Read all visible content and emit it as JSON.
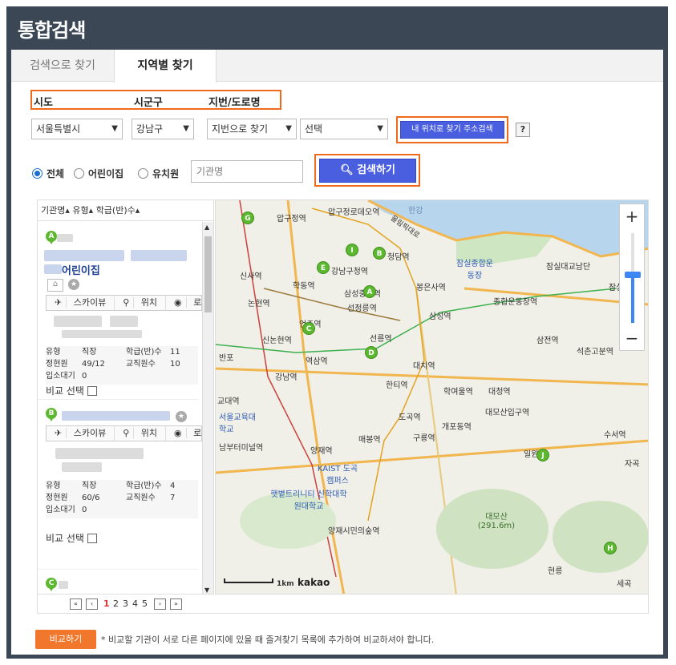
{
  "header": {
    "title": "통합검색"
  },
  "tabs": [
    {
      "label": "검색으로 찾기"
    },
    {
      "label": "지역별 찾기"
    }
  ],
  "filters": {
    "labels": {
      "sido": "시도",
      "sigungu": "시군구",
      "road": "지번/도로명"
    },
    "sido_value": "서울특별시",
    "sigungu_value": "강남구",
    "road_type_value": "지번으로 찾기",
    "detail_value": "선택",
    "locate_button": "내 위치로 찾기 주소검색",
    "help_button": "?"
  },
  "type_filter": {
    "options": [
      "전체",
      "어린이집",
      "유치원"
    ],
    "selected": "전체",
    "search_placeholder": "기관명",
    "search_button": "검색하기"
  },
  "list": {
    "headers": [
      "기관명",
      "유형",
      "학급(반)수"
    ],
    "cards": [
      {
        "marker": "A",
        "name": "어린이집",
        "actions": [
          "스카이뷰",
          "위치",
          "로드뷰"
        ],
        "type_label": "유형",
        "type_value": "직장",
        "class_label": "학급(반)수",
        "class_value": "11",
        "capacity_label": "정현원",
        "capacity_value": "49/12",
        "staff_label": "교직원수",
        "staff_value": "10",
        "waiting_label": "입소대기",
        "waiting_value": "0",
        "compare_label": "비교 선택"
      },
      {
        "marker": "B",
        "name": "",
        "actions": [
          "스카이뷰",
          "위치",
          "로드뷰"
        ],
        "type_label": "유형",
        "type_value": "직장",
        "class_label": "학급(반)수",
        "class_value": "4",
        "capacity_label": "정현원",
        "capacity_value": "60/6",
        "staff_label": "교직원수",
        "staff_value": "7",
        "waiting_label": "입소대기",
        "waiting_value": "0",
        "compare_label": "비교 선택"
      },
      {
        "marker": "C"
      }
    ]
  },
  "pagination": {
    "pages": [
      "1",
      "2",
      "3",
      "4",
      "5"
    ],
    "current": "1"
  },
  "map": {
    "scale": "1km",
    "brand": "kakao",
    "labels": [
      "압구정역",
      "압구정로데오역",
      "신사역",
      "강남구청역",
      "청담역",
      "학동역",
      "삼성중앙역",
      "봉은사역",
      "삼성역",
      "종합운동장역",
      "잠실역",
      "논현역",
      "선정릉역",
      "신논현역",
      "언주역",
      "선릉역",
      "삼전역",
      "역삼역",
      "강남역",
      "한티역",
      "대치역",
      "석촌고분역",
      "학여울역",
      "대청역",
      "대모산입구역",
      "도곡역",
      "개포동역",
      "구룡역",
      "매봉역",
      "양재역",
      "KAIST 도곡캠퍼스",
      "햇볕트리니티 신학대학원대학교",
      "양재시민의숲역",
      "서울교육대학교",
      "남부터미널역",
      "교대역",
      "대모산 (291.6m)",
      "수서역",
      "일원역",
      "자곡",
      "잠실종합운동장",
      "잠실대교남단",
      "올림픽대로",
      "반포",
      "한강",
      "현릉",
      "세곡"
    ],
    "markers": [
      "A",
      "B",
      "C",
      "D",
      "E",
      "G",
      "H",
      "I",
      "J"
    ]
  },
  "footer": {
    "compare_button": "비교하기",
    "note": "* 비교할 기관이 서로 다른 페이지에 있을 때 즐겨찾기 목록에 추가하여 비교하셔야 합니다."
  },
  "colors": {
    "frame": "#3c4756",
    "accent_blue": "#4a5ee0",
    "highlight": "#f06a1d",
    "marker_green": "#5cb82e"
  }
}
